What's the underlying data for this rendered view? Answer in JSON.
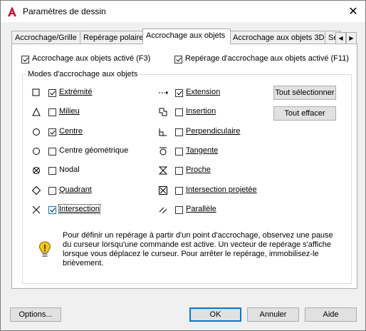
{
  "window": {
    "title": "Paramètres de dessin",
    "close": "✕"
  },
  "tabs": [
    {
      "label": "Accrochage/Grille"
    },
    {
      "label": "Repérage polaire"
    },
    {
      "label": "Accrochage aux objets"
    },
    {
      "label": "Accrochage aux objets 3D"
    },
    {
      "label": "Sé"
    }
  ],
  "tab_scroll": {
    "left": "◀",
    "right": "▶"
  },
  "top_options": {
    "osnap_on": {
      "label": "Accrochage aux objets activé (F3)",
      "checked": true
    },
    "otrack_on": {
      "label": "Repérage d'accrochage aux objets activé (F11)",
      "checked": true
    }
  },
  "group": {
    "title": "Modes d'accrochage aux objets"
  },
  "modes_left": [
    {
      "label": "Extrémité",
      "checked": true,
      "icon": "square-icon"
    },
    {
      "label": "Milieu",
      "checked": false,
      "icon": "triangle-icon"
    },
    {
      "label": "Centre",
      "checked": true,
      "icon": "circle-icon"
    },
    {
      "label": "Centre géométrique",
      "checked": false,
      "icon": "circle-icon"
    },
    {
      "label": "Nodal",
      "checked": false,
      "icon": "node-icon"
    },
    {
      "label": "Quadrant",
      "checked": false,
      "icon": "diamond-icon"
    },
    {
      "label": "Intersection",
      "checked": true,
      "icon": "x-icon"
    }
  ],
  "modes_right": [
    {
      "label": "Extension",
      "checked": true,
      "icon": "extension-icon"
    },
    {
      "label": "Insertion",
      "checked": false,
      "icon": "insertion-icon"
    },
    {
      "label": "Perpendiculaire",
      "checked": false,
      "icon": "perpendicular-icon"
    },
    {
      "label": "Tangente",
      "checked": false,
      "icon": "tangent-icon"
    },
    {
      "label": "Proche",
      "checked": false,
      "icon": "nearest-icon"
    },
    {
      "label": "Intersection projetée",
      "checked": false,
      "icon": "apparent-intersection-icon"
    },
    {
      "label": "Parallèle",
      "checked": false,
      "icon": "parallel-icon"
    }
  ],
  "buttons": {
    "select_all": "Tout sélectionner",
    "clear_all": "Tout effacer",
    "options": "Options...",
    "ok": "OK",
    "cancel": "Annuler",
    "help": "Aide"
  },
  "info": {
    "text": "Pour définir un repérage à partir d'un point d'accrochage, observez une pause du curseur lorsqu'une commande est active. Un vecteur de repérage s'affiche lorsque vous déplacez le curseur. Pour arrêter le repérage, immobilisez-le brièvement."
  },
  "colors": {
    "accent": "#0078d7",
    "app_icon": "#c8102e",
    "info_bulb": "#f5c518"
  }
}
